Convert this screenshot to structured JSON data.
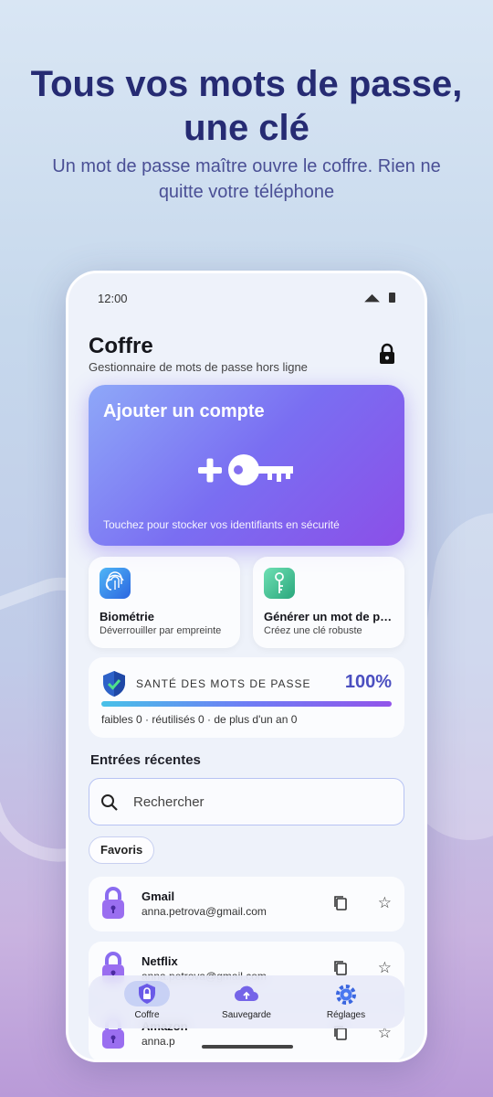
{
  "promo": {
    "headline": "Tous vos mots de passe, une clé",
    "subheadline": "Un mot de passe maître ouvre le coffre. Rien ne quitte votre téléphone"
  },
  "status_bar": {
    "time": "12:00"
  },
  "app": {
    "title": "Coffre",
    "subtitle": "Gestionnaire de mots de passe hors ligne"
  },
  "add_card": {
    "title": "Ajouter un compte",
    "hint": "Touchez pour stocker vos identifiants en sécurité"
  },
  "tiles": [
    {
      "title": "Biométrie",
      "subtitle": "Déverrouiller par empreinte",
      "icon": "fingerprint-icon"
    },
    {
      "title": "Générer un mot de passe",
      "subtitle": "Créez une clé robuste",
      "icon": "key-icon"
    }
  ],
  "health": {
    "label": "SANTÉ DES MOTS DE PASSE",
    "value": "100%",
    "progress": 1.0,
    "stats": "faibles 0 · réutilisés 0 · de plus d'un an 0"
  },
  "recent": {
    "heading": "Entrées récentes",
    "search_placeholder": "Rechercher",
    "chip": "Favoris",
    "entries": [
      {
        "name": "Gmail",
        "user": "anna.petrova@gmail.com"
      },
      {
        "name": "Netflix",
        "user": "anna.petrova@gmail.com"
      },
      {
        "name": "Amazon",
        "user": "anna.p"
      }
    ]
  },
  "nav": [
    {
      "label": "Coffre",
      "icon": "shield-icon",
      "active": true
    },
    {
      "label": "Sauvegarde",
      "icon": "cloud-upload-icon",
      "active": false
    },
    {
      "label": "Réglages",
      "icon": "gear-icon",
      "active": false
    }
  ],
  "colors": {
    "accent": "#4b4fc0",
    "headline": "#262b73",
    "card_gradient_start": "#8ea8f8",
    "card_gradient_end": "#8b4fe8"
  }
}
